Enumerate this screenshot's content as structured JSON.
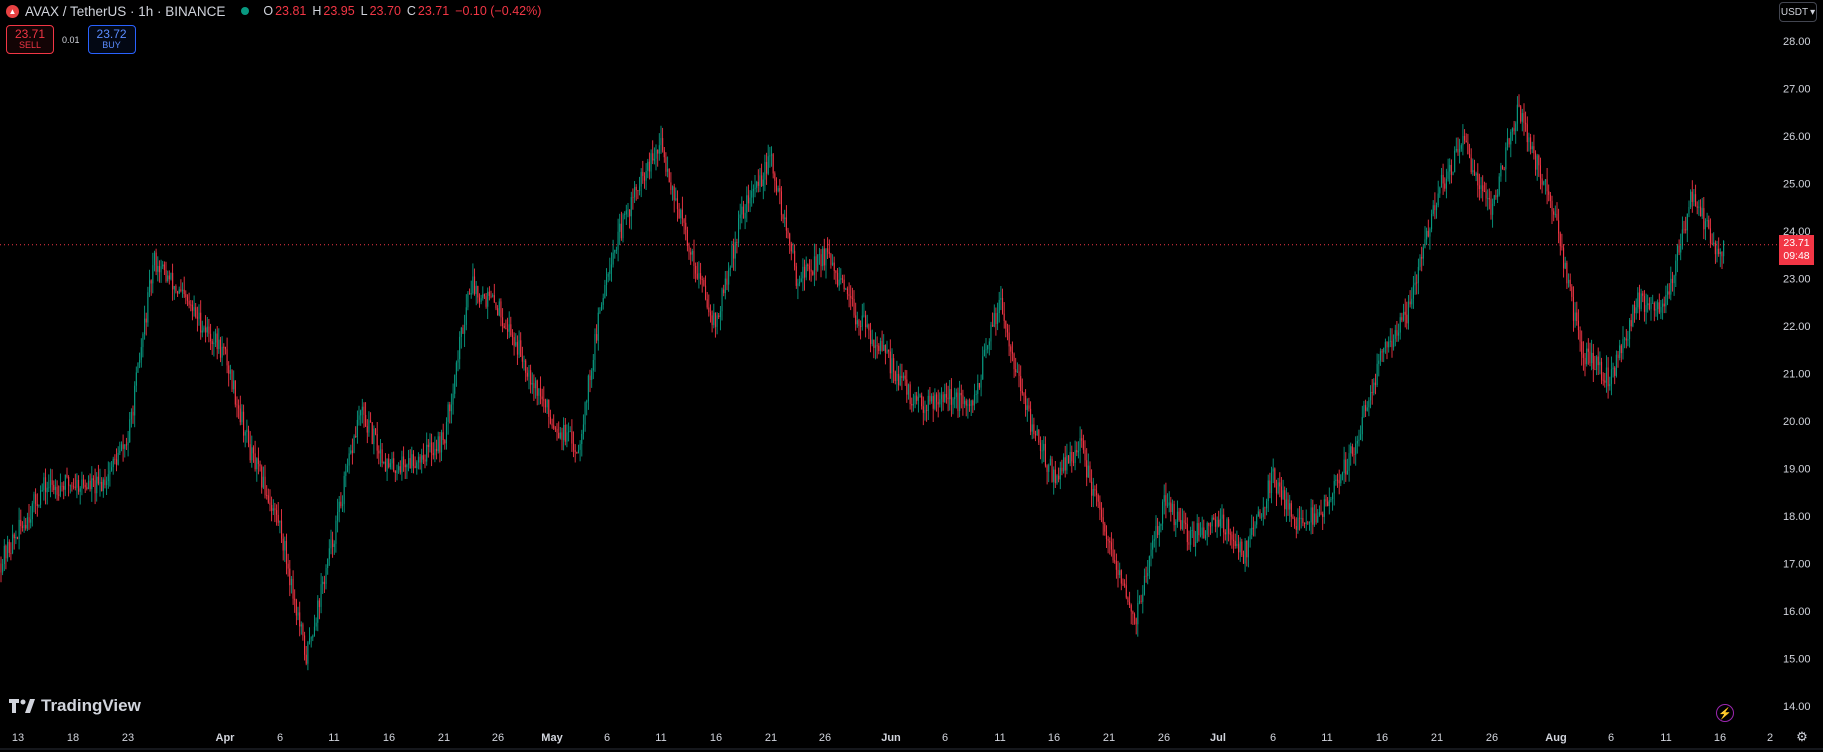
{
  "header": {
    "symbol_icon": "avax-logo-icon",
    "symbol": "AVAX / TetherUS · 1h · BINANCE",
    "status_icon": "market-open-dot",
    "open_key": "O",
    "open": "23.81",
    "high_key": "H",
    "high": "23.95",
    "low_key": "L",
    "low": "23.70",
    "close_key": "C",
    "close": "23.71",
    "change": "−0.10 (−0.42%)"
  },
  "trade": {
    "sell_price": "23.71",
    "sell_label": "SELL",
    "spread": "0.01",
    "buy_price": "23.72",
    "buy_label": "BUY"
  },
  "currency": {
    "label": "USDT",
    "chevron": "▾"
  },
  "last_price": {
    "value": "23.71",
    "countdown": "09:48"
  },
  "logo": {
    "text": "TradingView"
  },
  "colors": {
    "up": "#089981",
    "down": "#f23645",
    "background": "#000000",
    "text": "#d1d4dc"
  },
  "chart_data": {
    "type": "candlestick",
    "y_ticks": [
      "14.00",
      "15.00",
      "16.00",
      "17.00",
      "18.00",
      "19.00",
      "20.00",
      "21.00",
      "22.00",
      "23.00",
      "24.00",
      "25.00",
      "26.00",
      "27.00",
      "28.00"
    ],
    "ylim": [
      13.9,
      28.3
    ],
    "x_ticks": [
      "13",
      "18",
      "23",
      "Apr",
      "6",
      "11",
      "16",
      "21",
      "26",
      "May",
      "6",
      "11",
      "16",
      "21",
      "26",
      "Jun",
      "6",
      "11",
      "16",
      "21",
      "26",
      "Jul",
      "6",
      "11",
      "16",
      "21",
      "26",
      "Aug",
      "6",
      "11",
      "16",
      "2"
    ],
    "current_price": 23.71,
    "series": [
      {
        "name": "AVAX/USDT",
        "path": [
          [
            "13",
            17.0
          ],
          [
            "13",
            18.6
          ],
          [
            "18",
            18.7
          ],
          [
            "18",
            18.6
          ],
          [
            "23",
            19.6
          ],
          [
            "23",
            23.4
          ],
          [
            "Apr",
            21.4
          ],
          [
            "Apr",
            19.3
          ],
          [
            "6",
            17.8
          ],
          [
            "6",
            15.0
          ],
          [
            "11",
            17.6
          ],
          [
            "11",
            20.2
          ],
          [
            "16",
            19.0
          ],
          [
            "16",
            19.2
          ],
          [
            "21",
            19.6
          ],
          [
            "21",
            22.9
          ],
          [
            "26",
            22.4
          ],
          [
            "26",
            21.3
          ],
          [
            "May",
            20.0
          ],
          [
            "May",
            19.4
          ],
          [
            "6",
            23.2
          ],
          [
            "6",
            24.7
          ],
          [
            "11",
            25.8
          ],
          [
            "11",
            23.8
          ],
          [
            "16",
            22.0
          ],
          [
            "16",
            24.4
          ],
          [
            "21",
            25.5
          ],
          [
            "21",
            23.0
          ],
          [
            "26",
            23.5
          ],
          [
            "26",
            22.4
          ],
          [
            "Jun",
            21.2
          ],
          [
            "Jun",
            20.3
          ],
          [
            "6",
            20.6
          ],
          [
            "6",
            20.2
          ],
          [
            "11",
            22.6
          ],
          [
            "11",
            20.2
          ],
          [
            "16",
            18.8
          ],
          [
            "16",
            19.5
          ],
          [
            "21",
            17.3
          ],
          [
            "21",
            15.8
          ],
          [
            "26",
            18.3
          ],
          [
            "26",
            17.5
          ],
          [
            "Jul",
            18.0
          ],
          [
            "Jul",
            17.2
          ],
          [
            "6",
            18.8
          ],
          [
            "6",
            17.8
          ],
          [
            "11",
            18.2
          ],
          [
            "11",
            19.4
          ],
          [
            "16",
            21.4
          ],
          [
            "16",
            22.3
          ],
          [
            "21",
            24.8
          ],
          [
            "21",
            25.8
          ],
          [
            "26",
            24.5
          ],
          [
            "26",
            26.6
          ],
          [
            "Aug",
            24.2
          ],
          [
            "Aug",
            21.4
          ],
          [
            "6",
            20.9
          ],
          [
            "6",
            22.5
          ],
          [
            "11",
            22.5
          ],
          [
            "11",
            24.8
          ],
          [
            "16",
            23.4
          ],
          [
            "16",
            25.5
          ],
          [
            "2",
            23.71
          ]
        ]
      }
    ]
  }
}
